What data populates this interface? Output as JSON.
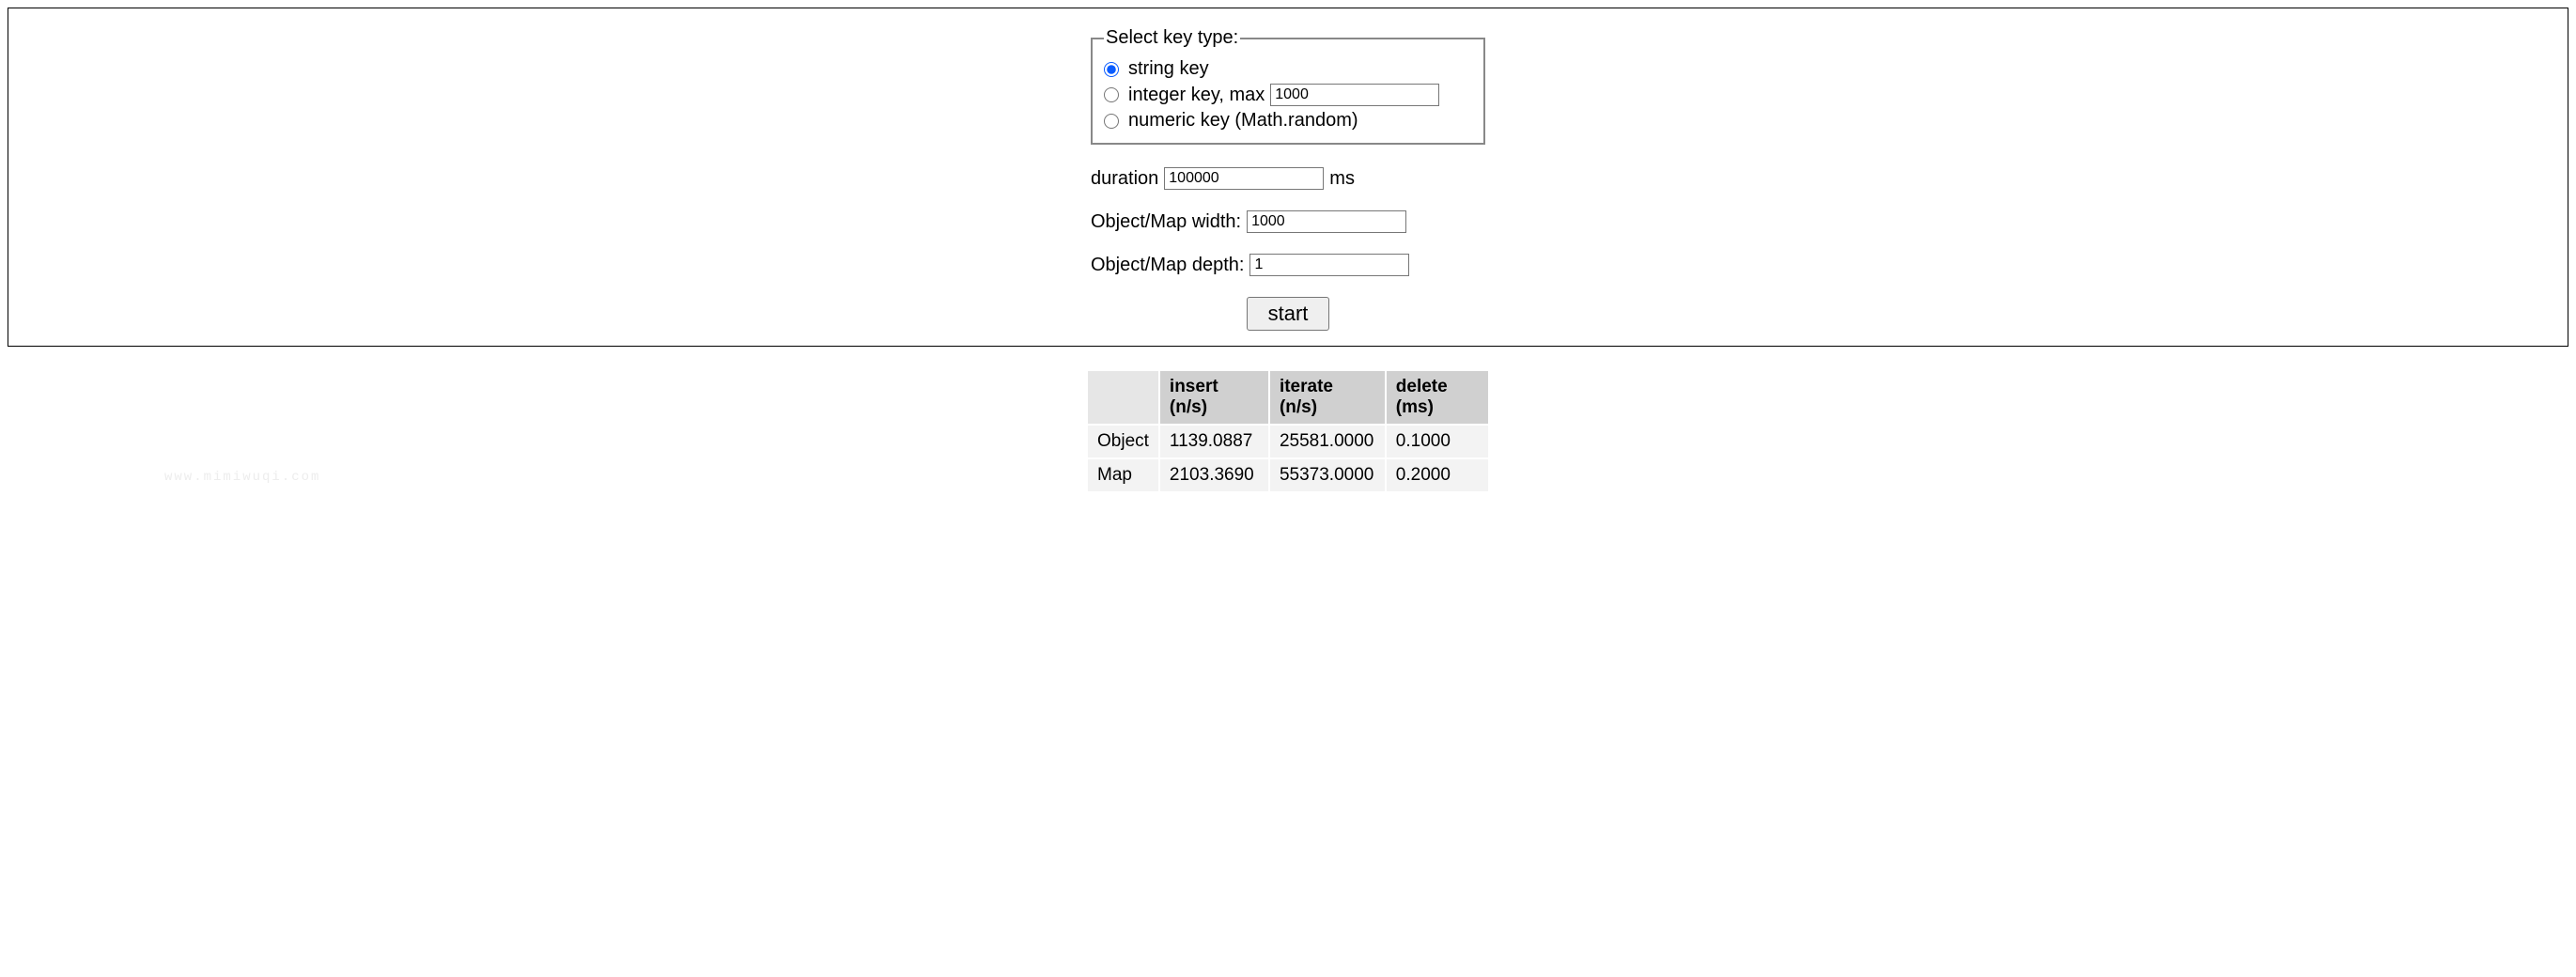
{
  "keytype": {
    "legend": "Select key type:",
    "options": {
      "string_label": "string key",
      "integer_label_prefix": "integer key, max",
      "integer_max_value": "1000",
      "numeric_label": "numeric key (Math.random)"
    },
    "selected": "string"
  },
  "duration": {
    "label": "duration",
    "value": "100000",
    "unit": "ms"
  },
  "width": {
    "label": "Object/Map width:",
    "value": "1000"
  },
  "depth": {
    "label": "Object/Map depth:",
    "value": "1"
  },
  "start_button": "start",
  "results": {
    "headers": {
      "col0": "",
      "col1": "insert (n/s)",
      "col2": "iterate (n/s)",
      "col3": "delete (ms)"
    },
    "rows": [
      {
        "name": "Object",
        "insert": "1139.0887",
        "iterate": "25581.0000",
        "delete": "0.1000"
      },
      {
        "name": "Map",
        "insert": "2103.3690",
        "iterate": "55373.0000",
        "delete": "0.2000"
      }
    ]
  },
  "watermark": "www.mimiwuqi.com"
}
